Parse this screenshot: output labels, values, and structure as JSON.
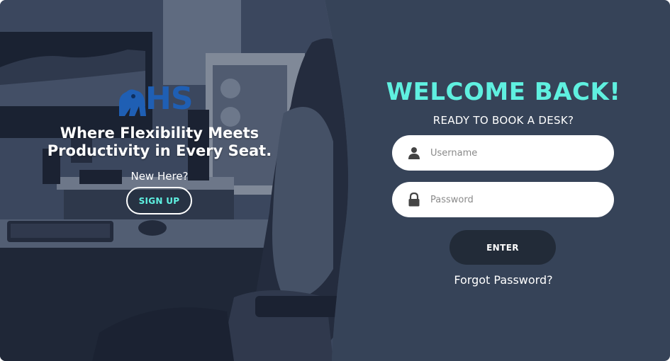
{
  "left_panel": {
    "logo_text": "HS",
    "tagline_line1": "Where Flexibility Meets",
    "tagline_line2": "Productivity in Every Seat.",
    "new_here": "New Here?",
    "signup_label": "SIGN UP"
  },
  "right_panel": {
    "welcome_title": "WELCOME BACK!",
    "subtitle": "READY TO BOOK A DESK?",
    "username": {
      "placeholder": "Username",
      "value": "",
      "icon": "user-icon"
    },
    "password": {
      "placeholder": "Password",
      "value": "",
      "icon": "lock-icon"
    },
    "enter_label": "ENTER",
    "forgot_label": "Forgot Password?"
  },
  "colors": {
    "panel_bg": "#364358",
    "accent": "#5ff0e0",
    "logo_blue": "#1f5fb4",
    "button_dark": "#222b38"
  }
}
